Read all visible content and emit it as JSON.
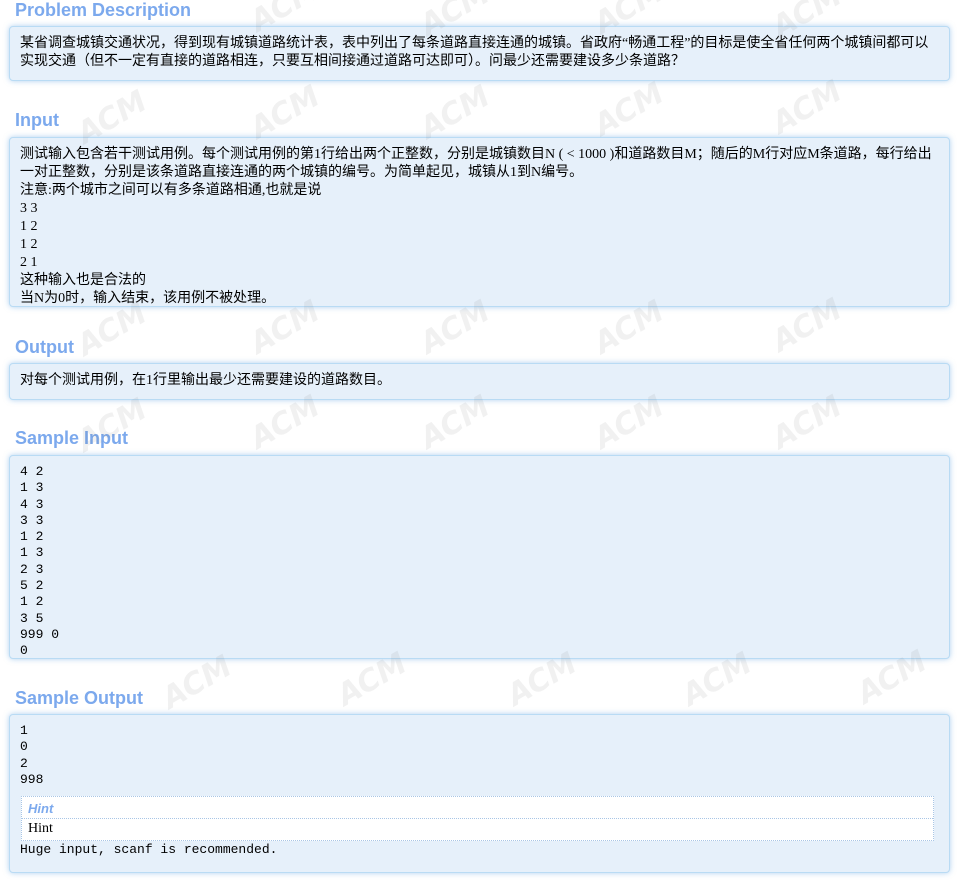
{
  "sections": {
    "problem": {
      "title": "Problem Description",
      "text": "某省调查城镇交通状况，得到现有城镇道路统计表，表中列出了每条道路直接连通的城镇。省政府“畅通工程”的目标是使全省任何两个城镇间都可以实现交通（但不一定有直接的道路相连，只要互相间接通过道路可达即可）。问最少还需要建设多少条道路？"
    },
    "input": {
      "title": "Input",
      "text": "测试输入包含若干测试用例。每个测试用例的第1行给出两个正整数，分别是城镇数目N ( < 1000 )和道路数目M；随后的M行对应M条道路，每行给出一对正整数，分别是该条道路直接连通的两个城镇的编号。为简单起见，城镇从1到N编号。\n注意:两个城市之间可以有多条道路相通,也就是说\n3 3\n1 2\n1 2\n2 1\n这种输入也是合法的\n当N为0时，输入结束，该用例不被处理。"
    },
    "output": {
      "title": "Output",
      "text": "对每个测试用例，在1行里输出最少还需要建设的道路数目。"
    },
    "sample_input": {
      "title": "Sample Input",
      "text": "4 2\n1 3\n4 3\n3 3\n1 2\n1 3\n2 3\n5 2\n1 2\n3 5\n999 0\n0"
    },
    "sample_output": {
      "title": "Sample Output",
      "text": "1\n0\n2\n998",
      "hint_title": "Hint",
      "hint_body": "Hint",
      "after_hint": "Huge input, scanf is recommended."
    }
  },
  "watermark": {
    "text_acm": "ACM",
    "text_alt": "ACM"
  },
  "colors": {
    "title": "#7ca9ed",
    "panel_bg": "#e6f0fa",
    "panel_border": "#b9dbf4"
  }
}
